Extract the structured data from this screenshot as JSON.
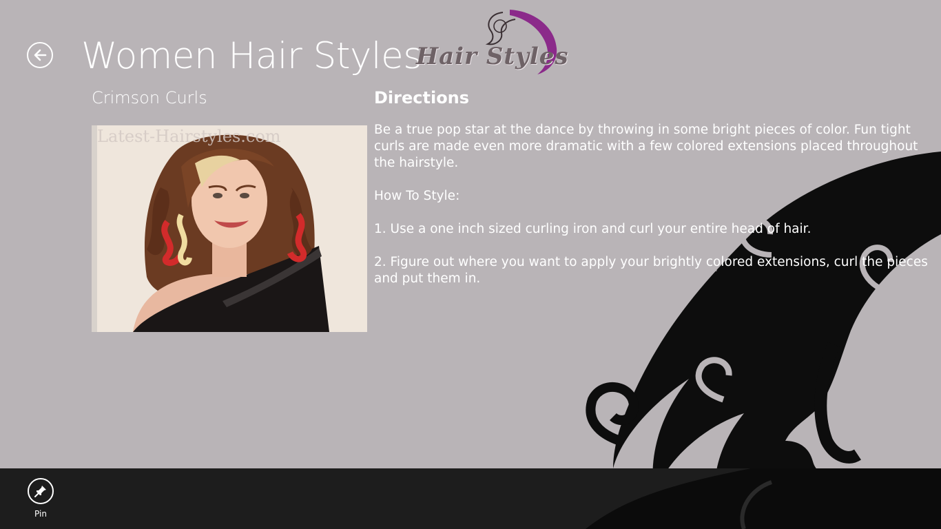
{
  "header": {
    "title": "Women Hair Styles",
    "back_icon": "back-arrow-icon",
    "logo_text": "Hair Styles"
  },
  "item": {
    "name": "Crimson Curls",
    "photo_watermark": "Latest-Hairstyles.com"
  },
  "directions": {
    "heading": "Directions",
    "paragraphs": [
      "Be a true pop star at the dance by throwing in some bright pieces of color. Fun tight curls are made even more dramatic with a few colored extensions placed throughout the hairstyle.",
      "How To Style:",
      "1. Use a one inch sized curling iron and curl your entire head of hair.",
      "2. Figure out where you want to apply your brightly colored extensions, curl the pieces and put them in."
    ]
  },
  "app_bar": {
    "pin_label": "Pin",
    "pin_icon": "pin-icon"
  },
  "colors": {
    "background": "#b9b4b7",
    "app_bar": "#1d1d1d",
    "text": "#ffffff",
    "logo_accent": "#8b2a8a"
  }
}
